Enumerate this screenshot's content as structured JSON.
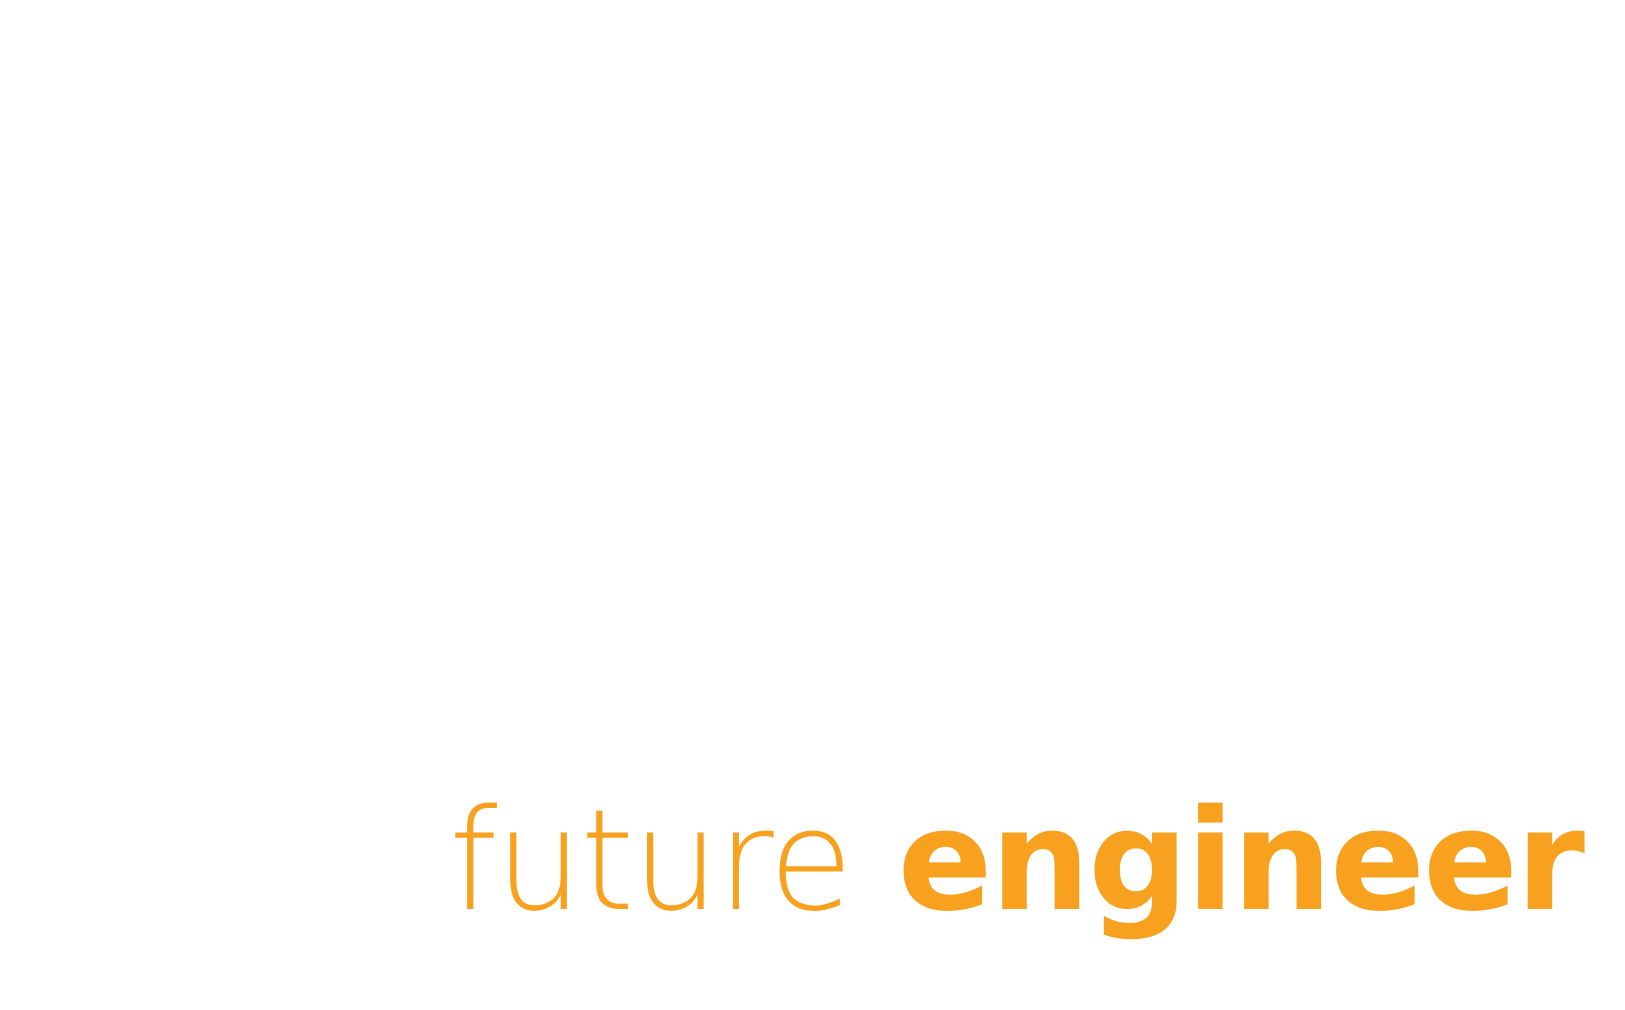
{
  "logo": {
    "word_light": "future",
    "word_bold": "engineer",
    "color": "#F7A11F"
  },
  "background": "#ffffff"
}
